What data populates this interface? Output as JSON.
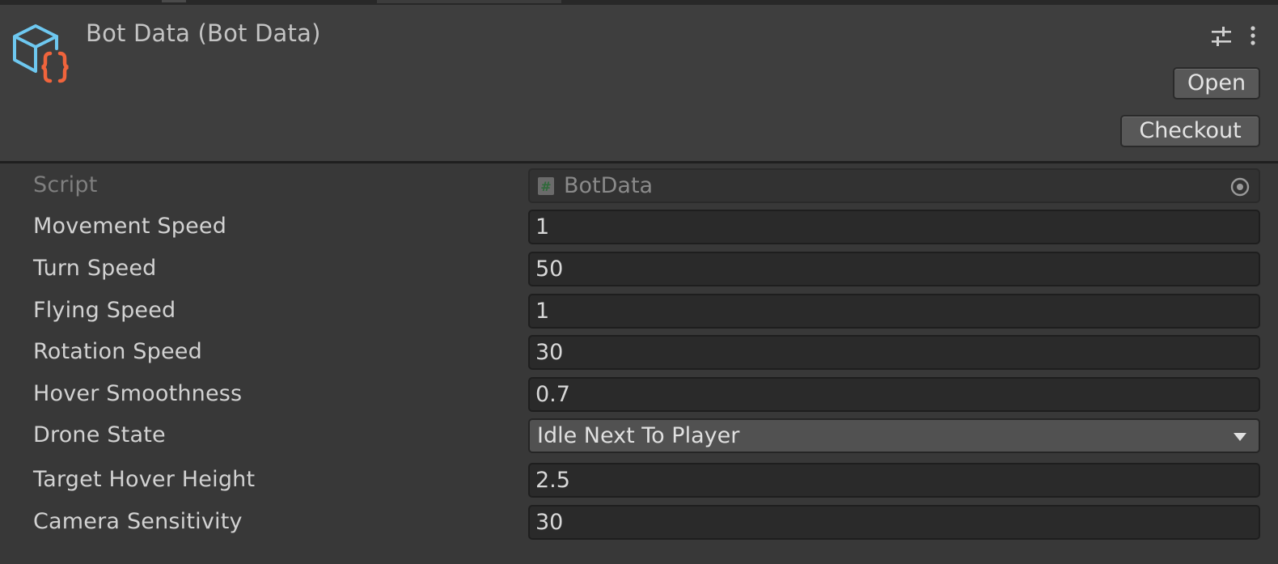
{
  "header": {
    "title": "Bot Data (Bot Data)",
    "open_label": "Open",
    "checkout_label": "Checkout",
    "asset_icon": "scriptable-object-icon",
    "settings_icon": "sliders-icon",
    "menu_icon": "kebab-menu-icon"
  },
  "properties": {
    "script": {
      "label": "Script",
      "value": "BotData",
      "icon": "csharp-script-icon"
    },
    "movement_speed": {
      "label": "Movement Speed",
      "value": "1"
    },
    "turn_speed": {
      "label": "Turn Speed",
      "value": "50"
    },
    "flying_speed": {
      "label": "Flying Speed",
      "value": "1"
    },
    "rotation_speed": {
      "label": "Rotation Speed",
      "value": "30"
    },
    "hover_smoothness": {
      "label": "Hover Smoothness",
      "value": "0.7"
    },
    "drone_state": {
      "label": "Drone State",
      "value": "Idle Next To Player"
    },
    "target_hover_height": {
      "label": "Target Hover Height",
      "value": "2.5"
    },
    "camera_sensitivity": {
      "label": "Camera Sensitivity",
      "value": "30"
    }
  },
  "colors": {
    "background": "#383838",
    "header_background": "#3e3e3e",
    "field_background": "#2a2a2a",
    "dropdown_background": "#515151",
    "icon_cube": "#6ec8f0",
    "icon_braces": "#f0643c"
  }
}
